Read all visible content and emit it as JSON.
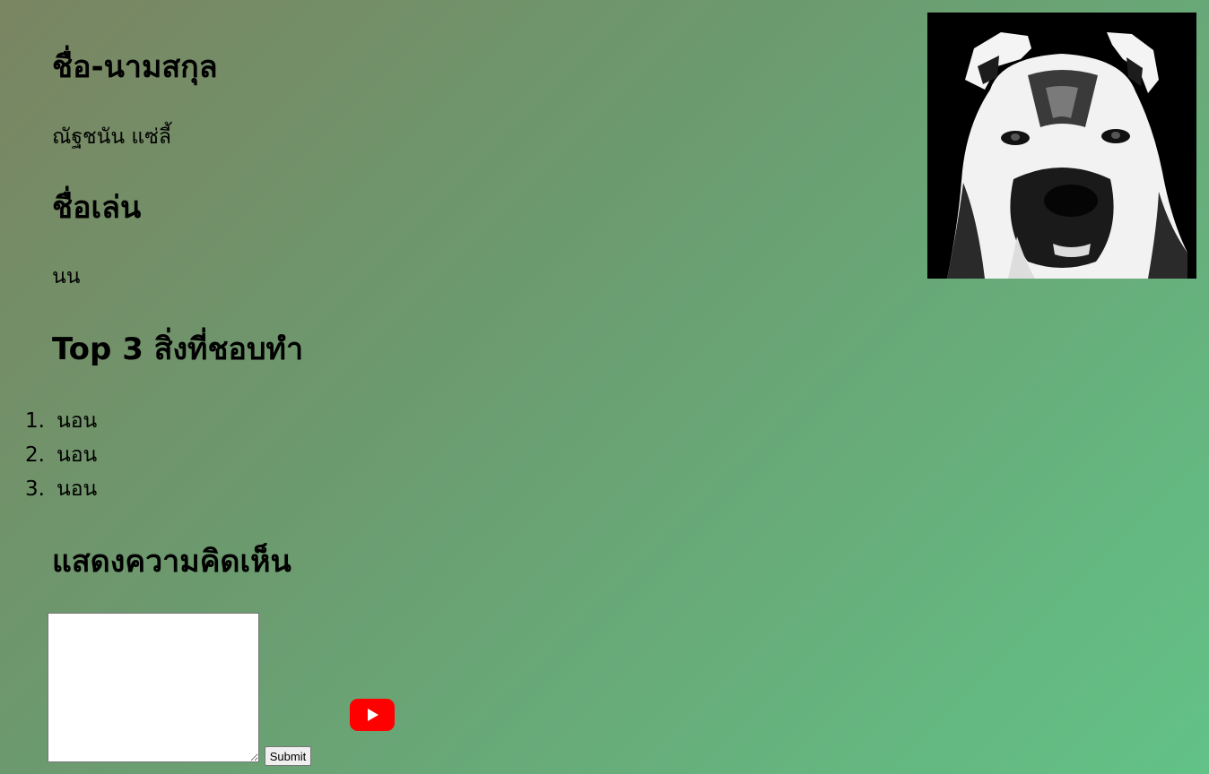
{
  "profile": {
    "name_heading": "ชื่อ-นามสกุล",
    "name_value": "ณัฐชนัน แซ่ลี้",
    "nickname_heading": "ชื่อเล่น",
    "nickname_value": "นน",
    "hobbies_heading": "Top 3 สิ่งที่ชอบทำ",
    "hobbies": [
      {
        "number": "1.",
        "text": "นอน"
      },
      {
        "number": "2.",
        "text": "นอน"
      },
      {
        "number": "3.",
        "text": "นอน"
      }
    ]
  },
  "comment": {
    "heading": "แสดงความคิดเห็น",
    "textarea_value": "",
    "submit_label": "Submit"
  },
  "icons": {
    "youtube": "youtube-play-icon",
    "photo": "dog-portrait-photo"
  },
  "colors": {
    "background_start": "#7a8562",
    "background_end": "#62c287",
    "youtube_red": "#ff0000"
  }
}
